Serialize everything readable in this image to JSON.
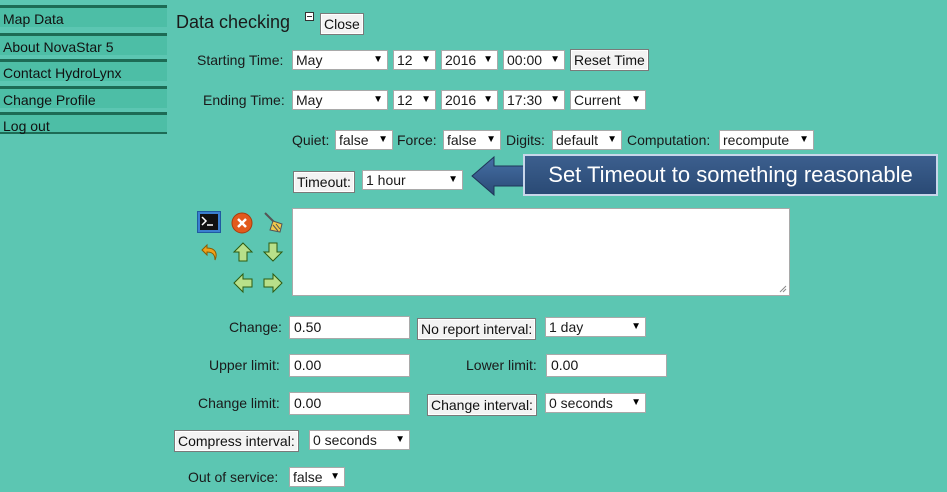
{
  "sidebar": {
    "items": [
      {
        "label": "Map Data"
      },
      {
        "label": "About NovaStar 5"
      },
      {
        "label": "Contact HydroLynx"
      },
      {
        "label": "Change Profile"
      },
      {
        "label": "Log out"
      }
    ]
  },
  "panel": {
    "title": "Data checking",
    "close_label": "Close"
  },
  "starting_time": {
    "label": "Starting Time:",
    "month": "May",
    "day": "12",
    "year": "2016",
    "time": "00:00",
    "reset_label": "Reset Time"
  },
  "ending_time": {
    "label": "Ending Time:",
    "month": "May",
    "day": "12",
    "year": "2016",
    "time": "17:30",
    "mode": "Current"
  },
  "options": {
    "quiet_label": "Quiet:",
    "quiet_value": "false",
    "force_label": "Force:",
    "force_value": "false",
    "digits_label": "Digits:",
    "digits_value": "default",
    "computation_label": "Computation:",
    "computation_value": "recompute"
  },
  "timeout": {
    "button_label": "Timeout:",
    "value": "1 hour"
  },
  "callout": {
    "text": "Set Timeout to something reasonable"
  },
  "toolbar_icons": [
    "terminal-icon",
    "cancel-icon",
    "broom-icon",
    "undo-icon",
    "arrow-up-icon",
    "arrow-down-icon",
    "arrow-left-icon",
    "arrow-right-icon"
  ],
  "fields": {
    "change_label": "Change:",
    "change_value": "0.50",
    "no_report_interval_label": "No report interval:",
    "no_report_interval_value": "1 day",
    "upper_limit_label": "Upper limit:",
    "upper_limit_value": "0.00",
    "lower_limit_label": "Lower limit:",
    "lower_limit_value": "0.00",
    "change_limit_label": "Change limit:",
    "change_limit_value": "0.00",
    "change_interval_label": "Change interval:",
    "change_interval_value": "0 seconds",
    "compress_interval_label": "Compress interval:",
    "compress_interval_value": "0 seconds",
    "out_of_service_label": "Out of service:",
    "out_of_service_value": "false"
  },
  "colors": {
    "background": "#5cc6b2",
    "sidebar_item": "#4dbea6",
    "sidebar_border": "#1d6b55",
    "callout_bg": "#2f5282"
  }
}
